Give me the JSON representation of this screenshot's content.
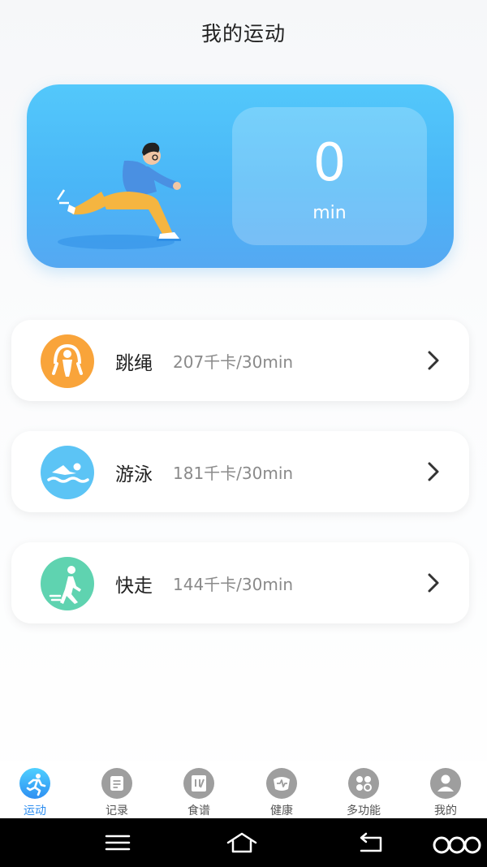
{
  "header": {
    "title": "我的运动"
  },
  "summary": {
    "value": "0",
    "unit": "min"
  },
  "exercises": [
    {
      "name": "跳绳",
      "stat": "207千卡/30min",
      "icon": "jump-rope-icon",
      "color": "#f9a43a"
    },
    {
      "name": "游泳",
      "stat": "181千卡/30min",
      "icon": "swimming-icon",
      "color": "#5cc4f5"
    },
    {
      "name": "快走",
      "stat": "144千卡/30min",
      "icon": "walking-icon",
      "color": "#5fd3b0"
    }
  ],
  "tabs": [
    {
      "label": "运动",
      "icon": "running-icon",
      "active": true
    },
    {
      "label": "记录",
      "icon": "record-icon",
      "active": false
    },
    {
      "label": "食谱",
      "icon": "recipe-icon",
      "active": false
    },
    {
      "label": "健康",
      "icon": "health-icon",
      "active": false
    },
    {
      "label": "多功能",
      "icon": "grid-icon",
      "active": false
    },
    {
      "label": "我的",
      "icon": "user-icon",
      "active": false
    }
  ],
  "colors": {
    "accent": "#2c8df0",
    "hero": "#4ab6f7"
  },
  "system_nav": [
    "menu",
    "home",
    "back"
  ]
}
